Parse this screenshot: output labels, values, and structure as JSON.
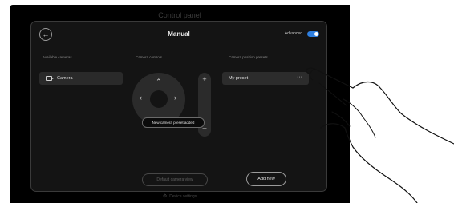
{
  "device": {
    "top_label": "Control panel",
    "footer_label": "Device settings"
  },
  "header": {
    "title": "Manual",
    "advanced_label": "Advanced",
    "advanced_on": true
  },
  "columns": {
    "cameras": "Available cameras",
    "controls": "Camera controls",
    "presets": "Camera position presets"
  },
  "cameras": [
    {
      "label": "Camera"
    }
  ],
  "presets": [
    {
      "label": "My preset",
      "menu": "···"
    }
  ],
  "controls": {
    "up": "⌃",
    "left": "‹",
    "right": "›",
    "zoom_in": "+",
    "zoom_out": "–"
  },
  "toast": "New camera preset added",
  "buttons": {
    "default_view": "Default camera view",
    "add_new": "Add new"
  },
  "colors": {
    "accent": "#2e7fe0",
    "panel": "#141414",
    "item": "#2a2a2a"
  }
}
